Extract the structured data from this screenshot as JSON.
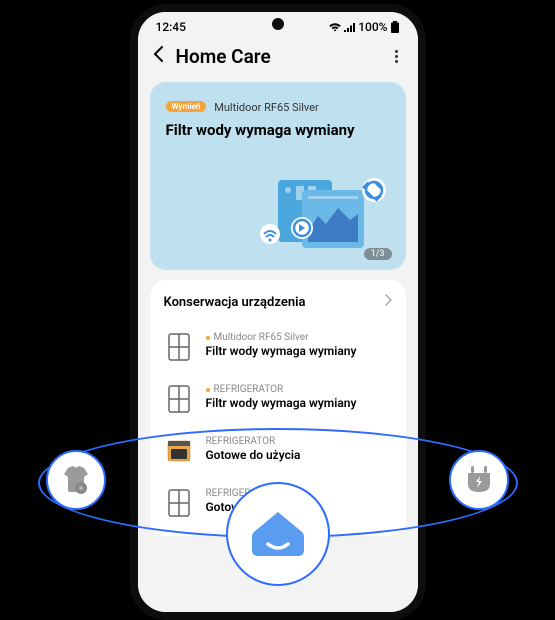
{
  "status": {
    "time": "12:45",
    "battery": "100%"
  },
  "appbar": {
    "title": "Home Care"
  },
  "hero": {
    "badge": "Wymień",
    "device": "Multidoor RF65 Silver",
    "headline": "Filtr wody wymaga wymiany",
    "pager": "1/3"
  },
  "maintenance": {
    "title": "Konserwacja urządzenia",
    "items": [
      {
        "name": "Multidoor RF65 Silver",
        "status": "Filtr wody wymaga wymiany",
        "icon": "fridge",
        "alert": true
      },
      {
        "name": "REFRIGERATOR",
        "status": "Filtr wody wymaga wymiany",
        "icon": "fridge",
        "alert": true
      },
      {
        "name": "REFRIGERATOR",
        "status": "Gotowe do użycia",
        "icon": "oven",
        "alert": false
      },
      {
        "name": "REFRIGERATOR",
        "status": "Gotowe do użycia",
        "icon": "fridge",
        "alert": false
      }
    ]
  }
}
